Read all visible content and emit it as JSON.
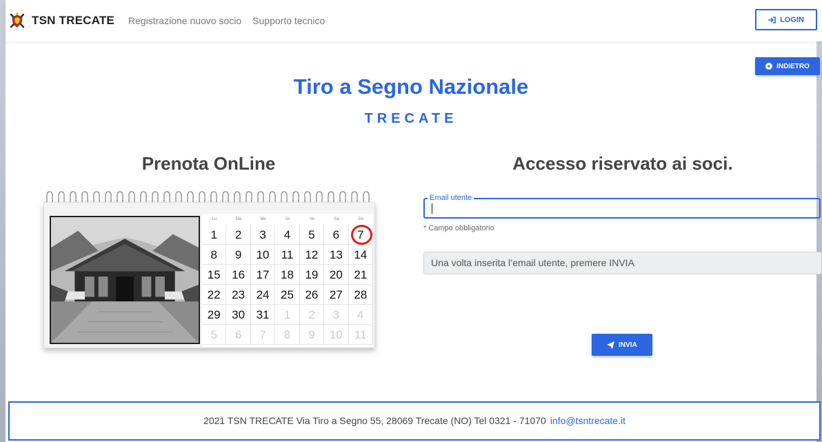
{
  "navbar": {
    "brand": "TSN TRECATE",
    "links": [
      "Registrazione nuovo socio",
      "Supporto tecnico"
    ],
    "login_label": "LOGIN"
  },
  "back_label": "INDIETRO",
  "header": {
    "title": "Tiro a Segno Nazionale",
    "subtitle": "TRECATE"
  },
  "left_section": {
    "heading": "Prenota OnLine",
    "calendar": {
      "weekdays": [
        "Lu",
        "Ma",
        "Me",
        "Gi",
        "Ve",
        "Sa",
        "Do"
      ],
      "days": [
        [
          "1",
          "2",
          "3",
          "4",
          "5",
          "6",
          "7"
        ],
        [
          "8",
          "9",
          "10",
          "11",
          "12",
          "13",
          "14"
        ],
        [
          "15",
          "16",
          "17",
          "18",
          "19",
          "20",
          "21"
        ],
        [
          "22",
          "23",
          "24",
          "25",
          "26",
          "27",
          "28"
        ],
        [
          "29",
          "30",
          "31",
          "1",
          "2",
          "3",
          "4"
        ],
        [
          "5",
          "6",
          "7",
          "8",
          "9",
          "10",
          "11"
        ]
      ],
      "highlighted_day": "7"
    }
  },
  "right_section": {
    "heading": "Accesso riservato ai soci.",
    "email_label": "Email utente",
    "email_value": "",
    "required_note": "* Campo obbligatorio",
    "info_text": "Una volta inserita l’email utente, premere INVIA",
    "send_label": "INVIA"
  },
  "footer": {
    "text": "2021 TSN TRECATE Via Tiro a Segno 55, 28069 Trecate (NO) Tel 0321 - 71070",
    "email": "info@tsntrecate.it"
  },
  "colors": {
    "accent": "#2c66e0",
    "highlight_circle": "#e01c1c"
  }
}
